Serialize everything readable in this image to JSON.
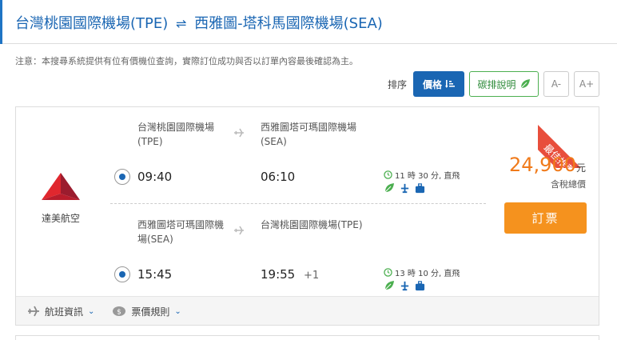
{
  "header": {
    "origin": "台灣桃園國際機場(TPE)",
    "swap_symbol": "⇌",
    "destination": "西雅圖-塔科馬國際機場(SEA)"
  },
  "notice": "注意：本搜尋系統提供有位有價機位查詢，實際訂位成功與否以訂單內容最後確認為主。",
  "sortbar": {
    "label": "排序",
    "price_label": "價格",
    "carbon_label": "碳排說明",
    "font_decrease": "A-",
    "font_increase": "A+"
  },
  "flight": {
    "airline_name": "達美航空",
    "ribbon": "最佳推薦",
    "legs": [
      {
        "from_airport": "台灣桃園國際機場(TPE)",
        "to_airport": "西雅圖塔可瑪國際機場(SEA)",
        "dep_time": "09:40",
        "arr_time": "06:10",
        "day_offset": "",
        "duration": "11 時 30 分, 直飛"
      },
      {
        "from_airport": "西雅圖塔可瑪國際機場(SEA)",
        "to_airport": "台灣桃園國際機場(TPE)",
        "dep_time": "15:45",
        "arr_time": "19:55",
        "day_offset": "+1",
        "duration": "13 時 10 分, 直飛"
      }
    ],
    "price": "24,900",
    "currency": "元",
    "tax_note": "含稅總價",
    "book_label": "訂票"
  },
  "footer": {
    "flight_info": "航班資訊",
    "fare_rules": "票價規則"
  },
  "colors": {
    "brand_blue": "#1a66b3",
    "price_orange": "#f07a1a",
    "book_orange": "#f5921e",
    "ribbon_red": "#e84e3c",
    "green": "#4caf50"
  }
}
